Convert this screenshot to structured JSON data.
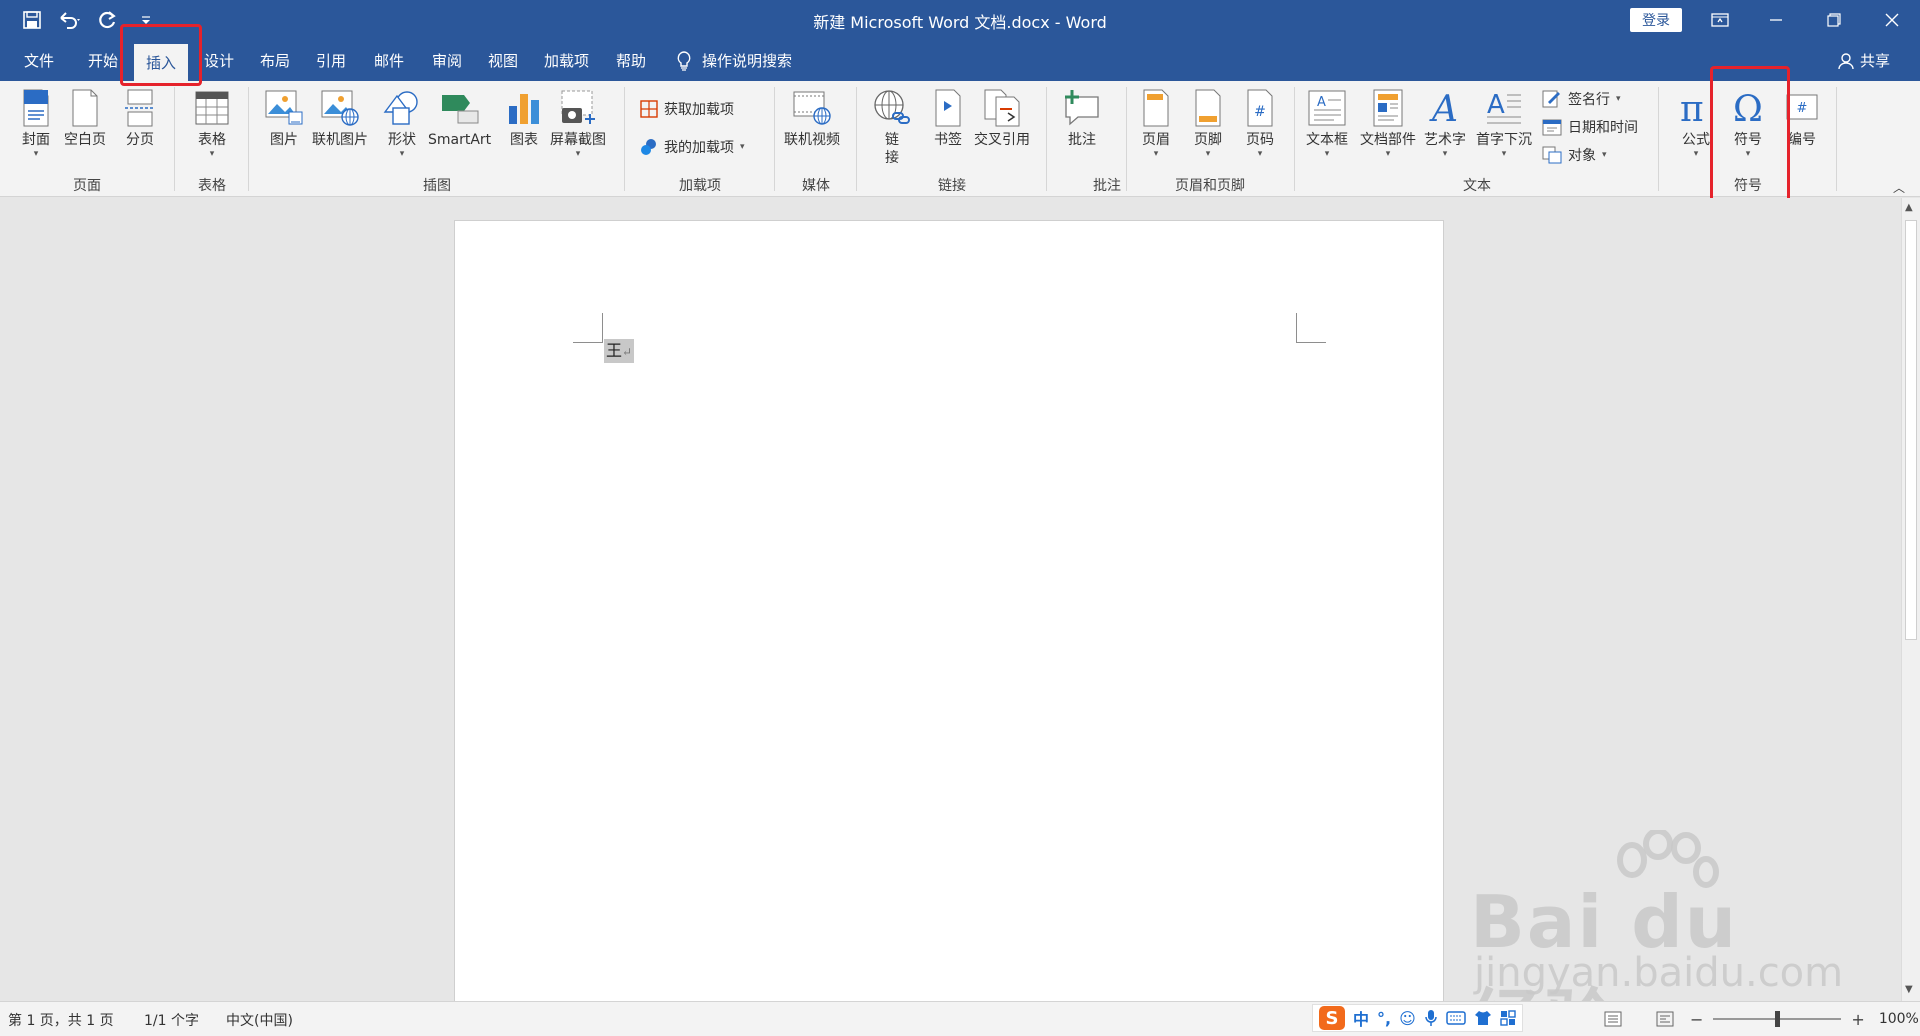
{
  "window": {
    "title": "新建 Microsoft Word 文档.docx  -  Word",
    "login_label": "登录"
  },
  "tabs": [
    {
      "label": "文件",
      "active": false
    },
    {
      "label": "开始",
      "active": false
    },
    {
      "label": "插入",
      "active": true
    },
    {
      "label": "设计",
      "active": false
    },
    {
      "label": "布局",
      "active": false
    },
    {
      "label": "引用",
      "active": false
    },
    {
      "label": "邮件",
      "active": false
    },
    {
      "label": "审阅",
      "active": false
    },
    {
      "label": "视图",
      "active": false
    },
    {
      "label": "加载项",
      "active": false
    },
    {
      "label": "帮助",
      "active": false
    }
  ],
  "tell_me": "操作说明搜索",
  "share_label": "共享",
  "ribbon": {
    "groups": {
      "pages": "页面",
      "tables": "表格",
      "illustrations": "插图",
      "addins": "加载项",
      "media": "媒体",
      "links": "链接",
      "comments": "批注",
      "header_footer": "页眉和页脚",
      "text": "文本",
      "symbols": "符号"
    },
    "buttons": {
      "cover": "封面",
      "blank_page": "空白页",
      "page_break": "分页",
      "table": "表格",
      "pictures": "图片",
      "online_pictures": "联机图片",
      "shapes": "形状",
      "smartart": "SmartArt",
      "chart": "图表",
      "screenshot": "屏幕截图",
      "get_addins": "获取加载项",
      "my_addins": "我的加载项",
      "online_video": "联机视频",
      "link_1": "链",
      "link_2": "接",
      "bookmark": "书签",
      "cross_reference": "交叉引用",
      "comment": "批注",
      "header": "页眉",
      "footer": "页脚",
      "page_number": "页码",
      "text_box": "文本框",
      "quick_parts": "文档部件",
      "wordart": "艺术字",
      "drop_cap": "首字下沉",
      "signature_line": "签名行",
      "date_time": "日期和时间",
      "object": "对象",
      "equation": "公式",
      "symbol": "符号",
      "numbering": "编号"
    }
  },
  "document": {
    "text": "王",
    "para_mark": "↵"
  },
  "status": {
    "page": "第 1 页，共 1 页",
    "words": "1/1 个字",
    "language": "中文(中国)",
    "zoom": "100%",
    "zoom_level": 1.0
  },
  "ime": {
    "mode": "中",
    "punct": "°,"
  },
  "watermark": {
    "brand": "Bai du 经验",
    "url": "jingyan.baidu.com"
  },
  "colors": {
    "brand_blue": "#2b579a",
    "highlight_red": "#e5222b"
  }
}
